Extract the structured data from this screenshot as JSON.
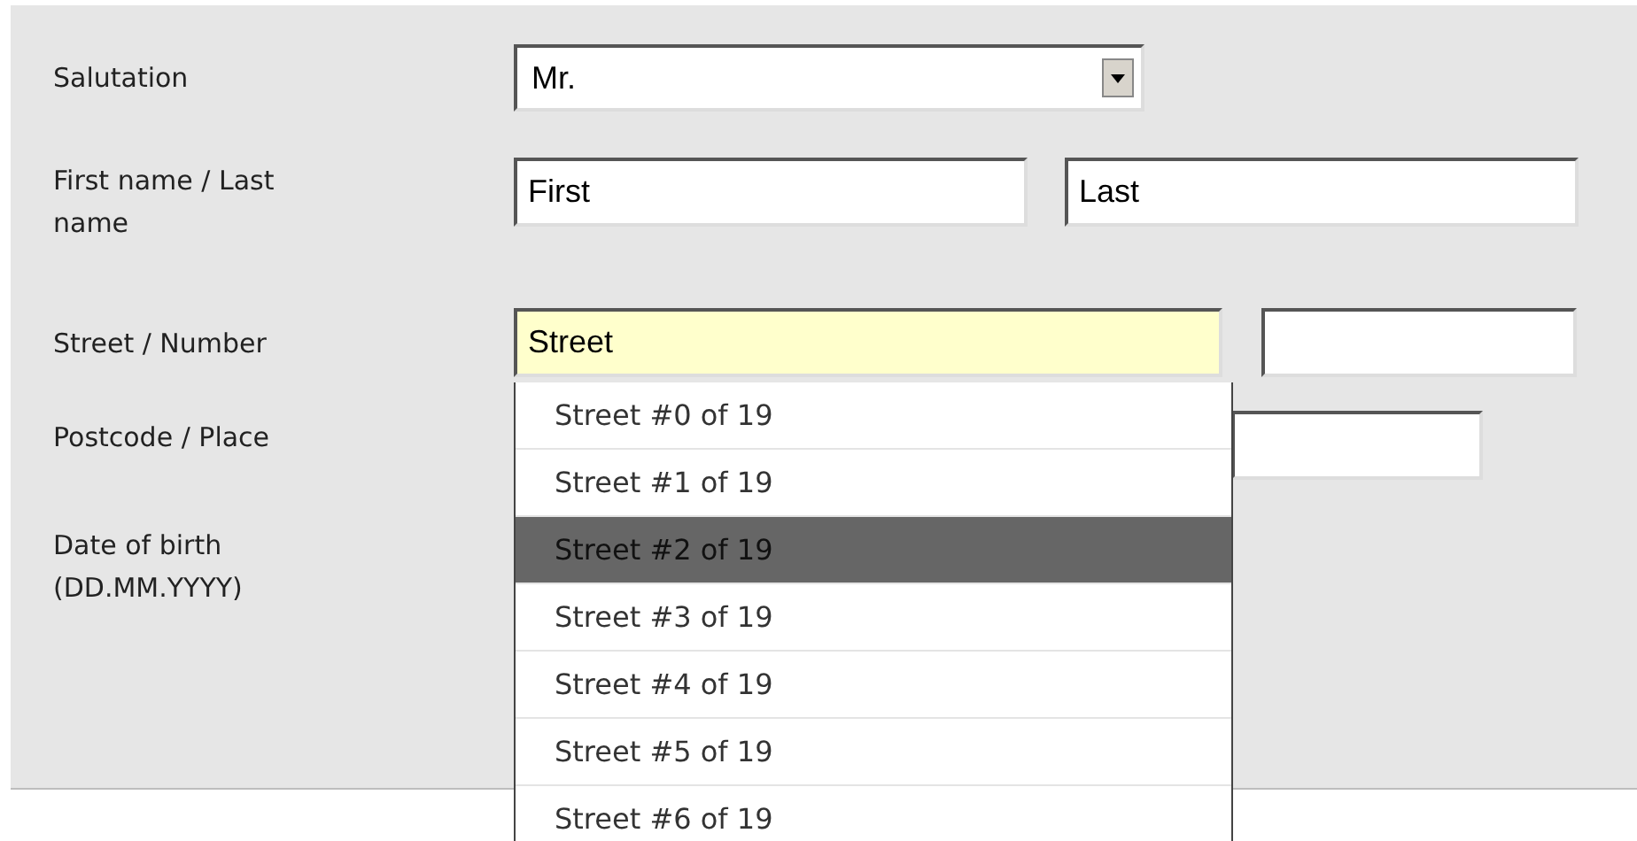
{
  "rows": [
    {
      "kind": "select",
      "label": "Salutation",
      "value": "Mr."
    },
    {
      "kind": "pair",
      "label": "First name / Last name",
      "values": [
        "First",
        "Last"
      ]
    },
    {
      "kind": "street",
      "label": "Street / Number",
      "value": "Street",
      "focused": true
    },
    {
      "kind": "place",
      "label": "Postcode / Place"
    },
    {
      "kind": "blank",
      "label": "Date of birth (DD.MM.YYYY)"
    }
  ],
  "suggestions": [
    {
      "text": "Street #0 of 19",
      "selected": false
    },
    {
      "text": "Street #1 of 19",
      "selected": false
    },
    {
      "text": "Street #2 of 19",
      "selected": true
    },
    {
      "text": "Street #3 of 19",
      "selected": false
    },
    {
      "text": "Street #4 of 19",
      "selected": false
    },
    {
      "text": "Street #5 of 19",
      "selected": false
    },
    {
      "text": "Street #6 of 19",
      "selected": false
    }
  ]
}
